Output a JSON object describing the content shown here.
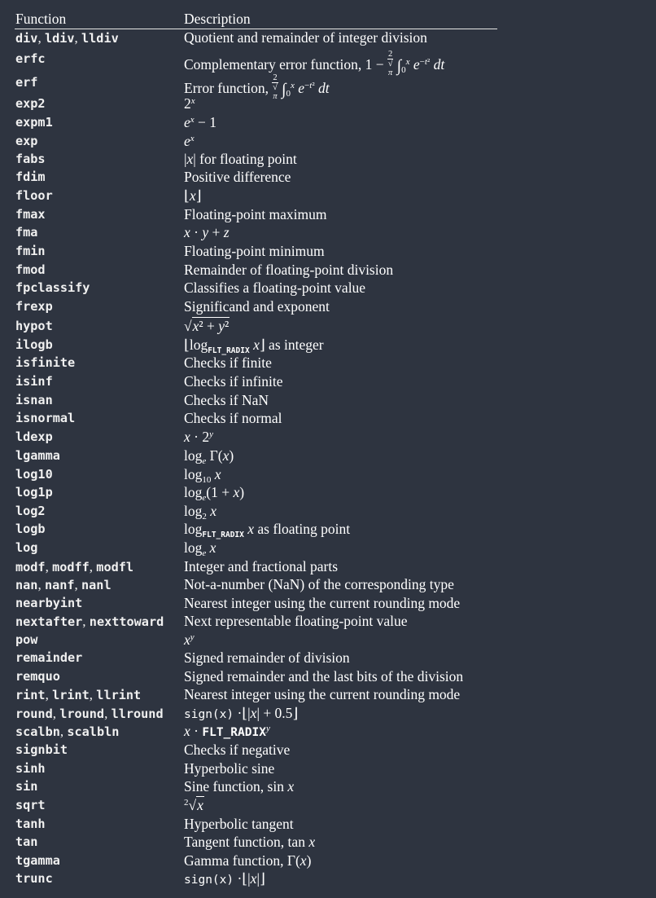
{
  "header": {
    "col1": "Function",
    "col2": "Description"
  },
  "rows": [
    {
      "fn": [
        "div",
        "ldiv",
        "lldiv"
      ],
      "desc": "Quotient and remainder of integer division"
    },
    {
      "fn": [
        "erfc"
      ],
      "desc": "Complementary error function, 1 − 2/√π ∫₀ˣ e^(−t²) dt"
    },
    {
      "fn": [
        "erf"
      ],
      "desc": "Error function, 2/√π ∫₀ˣ e^(−t²) dt"
    },
    {
      "fn": [
        "exp2"
      ],
      "desc": "2^x"
    },
    {
      "fn": [
        "expm1"
      ],
      "desc": "e^x − 1"
    },
    {
      "fn": [
        "exp"
      ],
      "desc": "e^x"
    },
    {
      "fn": [
        "fabs"
      ],
      "desc": "|x| for floating point"
    },
    {
      "fn": [
        "fdim"
      ],
      "desc": "Positive difference"
    },
    {
      "fn": [
        "floor"
      ],
      "desc": "⌊x⌋"
    },
    {
      "fn": [
        "fmax"
      ],
      "desc": "Floating-point maximum"
    },
    {
      "fn": [
        "fma"
      ],
      "desc": "x · y + z"
    },
    {
      "fn": [
        "fmin"
      ],
      "desc": "Floating-point minimum"
    },
    {
      "fn": [
        "fmod"
      ],
      "desc": "Remainder of floating-point division"
    },
    {
      "fn": [
        "fpclassify"
      ],
      "desc": "Classifies a floating-point value"
    },
    {
      "fn": [
        "frexp"
      ],
      "desc": "Significand and exponent"
    },
    {
      "fn": [
        "hypot"
      ],
      "desc": "√(x² + y²)"
    },
    {
      "fn": [
        "ilogb"
      ],
      "desc": "⌊log_FLT_RADIX x⌋ as integer"
    },
    {
      "fn": [
        "isfinite"
      ],
      "desc": "Checks if finite"
    },
    {
      "fn": [
        "isinf"
      ],
      "desc": "Checks if infinite"
    },
    {
      "fn": [
        "isnan"
      ],
      "desc": "Checks if NaN"
    },
    {
      "fn": [
        "isnormal"
      ],
      "desc": "Checks if normal"
    },
    {
      "fn": [
        "ldexp"
      ],
      "desc": "x · 2^y"
    },
    {
      "fn": [
        "lgamma"
      ],
      "desc": "log_e Γ(x)"
    },
    {
      "fn": [
        "log10"
      ],
      "desc": "log₁₀ x"
    },
    {
      "fn": [
        "log1p"
      ],
      "desc": "log_e(1 + x)"
    },
    {
      "fn": [
        "log2"
      ],
      "desc": "log₂ x"
    },
    {
      "fn": [
        "logb"
      ],
      "desc": "log_FLT_RADIX x as floating point"
    },
    {
      "fn": [
        "log"
      ],
      "desc": "log_e x"
    },
    {
      "fn": [
        "modf",
        "modff",
        "modfl"
      ],
      "desc": "Integer and fractional parts"
    },
    {
      "fn": [
        "nan",
        "nanf",
        "nanl"
      ],
      "desc": "Not-a-number (NaN) of the corresponding type"
    },
    {
      "fn": [
        "nearbyint"
      ],
      "desc": "Nearest integer using the current rounding mode"
    },
    {
      "fn": [
        "nextafter",
        "nexttoward"
      ],
      "desc": "Next representable floating-point value"
    },
    {
      "fn": [
        "pow"
      ],
      "desc": "x^y"
    },
    {
      "fn": [
        "remainder"
      ],
      "desc": "Signed remainder of division"
    },
    {
      "fn": [
        "remquo"
      ],
      "desc": "Signed remainder and the last bits of the division"
    },
    {
      "fn": [
        "rint",
        "lrint",
        "llrint"
      ],
      "desc": "Nearest integer using the current rounding mode"
    },
    {
      "fn": [
        "round",
        "lround",
        "llround"
      ],
      "desc": "sign(x) · ⌊|x| + 0.5⌋"
    },
    {
      "fn": [
        "scalbn",
        "scalbln"
      ],
      "desc": "x · FLT_RADIX^y"
    },
    {
      "fn": [
        "signbit"
      ],
      "desc": "Checks if negative"
    },
    {
      "fn": [
        "sinh"
      ],
      "desc": "Hyperbolic sine"
    },
    {
      "fn": [
        "sin"
      ],
      "desc": "Sine function, sin x"
    },
    {
      "fn": [
        "sqrt"
      ],
      "desc": "²√x"
    },
    {
      "fn": [
        "tanh"
      ],
      "desc": "Hyperbolic tangent"
    },
    {
      "fn": [
        "tan"
      ],
      "desc": "Tangent function, tan x"
    },
    {
      "fn": [
        "tgamma"
      ],
      "desc": "Gamma function, Γ(x)"
    },
    {
      "fn": [
        "trunc"
      ],
      "desc": "sign(x) · ⌊|x|⌋"
    }
  ]
}
